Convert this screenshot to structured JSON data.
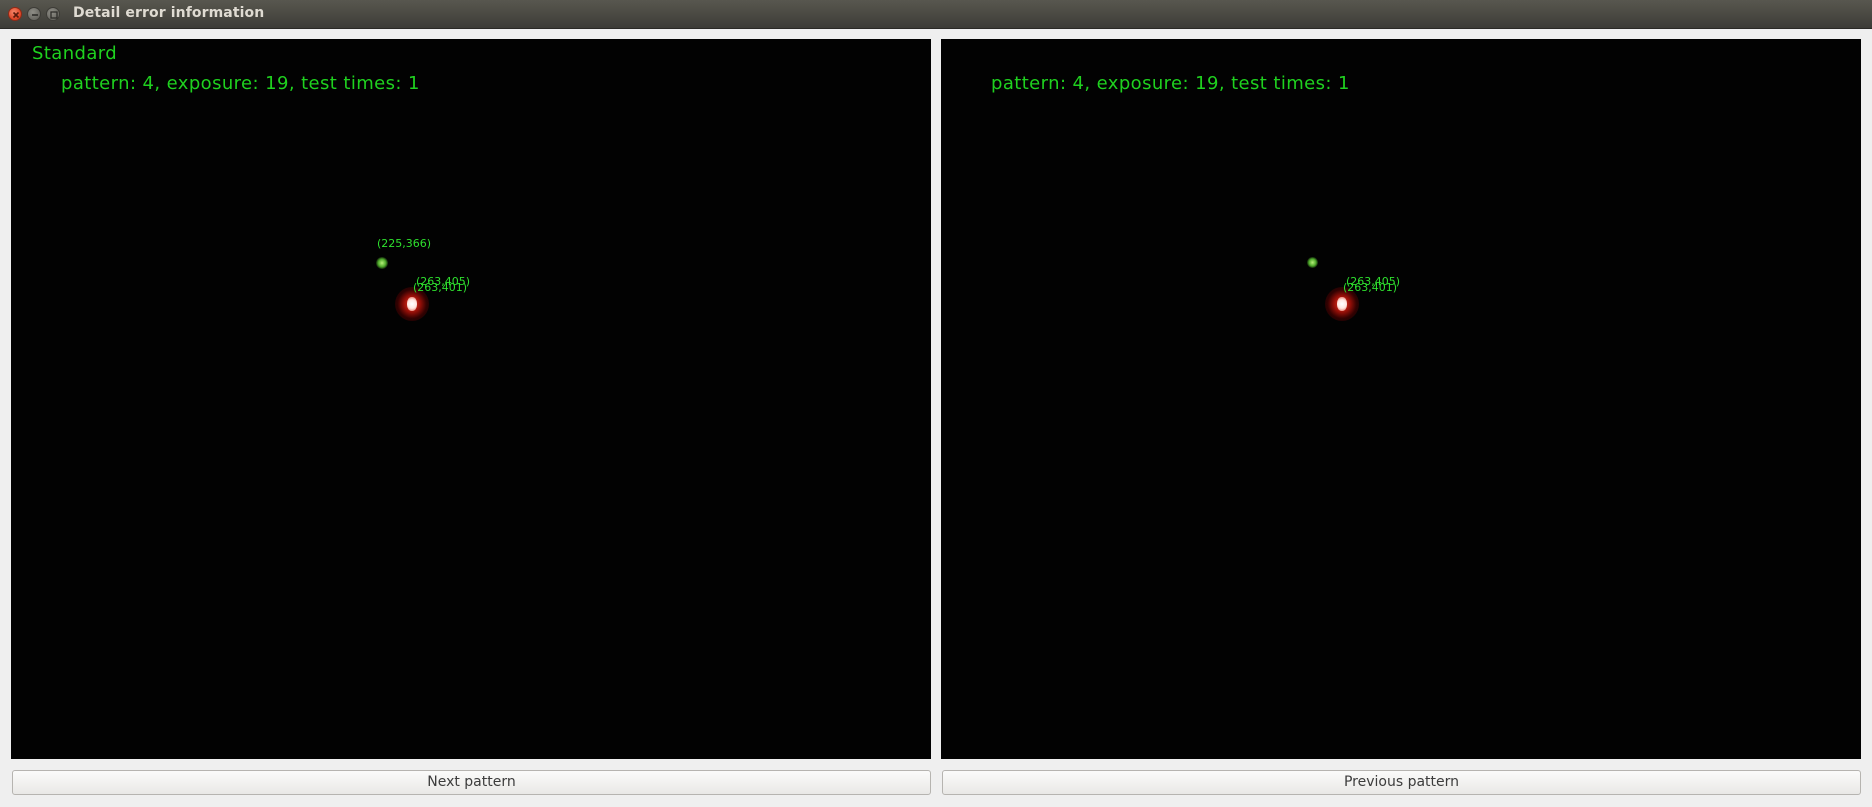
{
  "window": {
    "title": "Detail error information"
  },
  "left_pane": {
    "heading": "Standard",
    "info": "pattern: 4, exposure: 19, test times: 1",
    "coords": {
      "green_spot": "(225,366)",
      "red_spot_a": "(263,405)",
      "red_spot_b": "(263,401)"
    }
  },
  "right_pane": {
    "info": "pattern: 4, exposure: 19, test times: 1",
    "coords": {
      "red_spot_a": "(263,405)",
      "red_spot_b": "(263,401)"
    }
  },
  "buttons": {
    "next": "Next pattern",
    "previous": "Previous pattern"
  },
  "colors": {
    "overlay_text": "#1fd11f",
    "background": "#020202",
    "window": "#efefef"
  },
  "icons": {
    "close": "close-icon",
    "minimize": "minimize-icon",
    "maximize": "maximize-icon"
  }
}
